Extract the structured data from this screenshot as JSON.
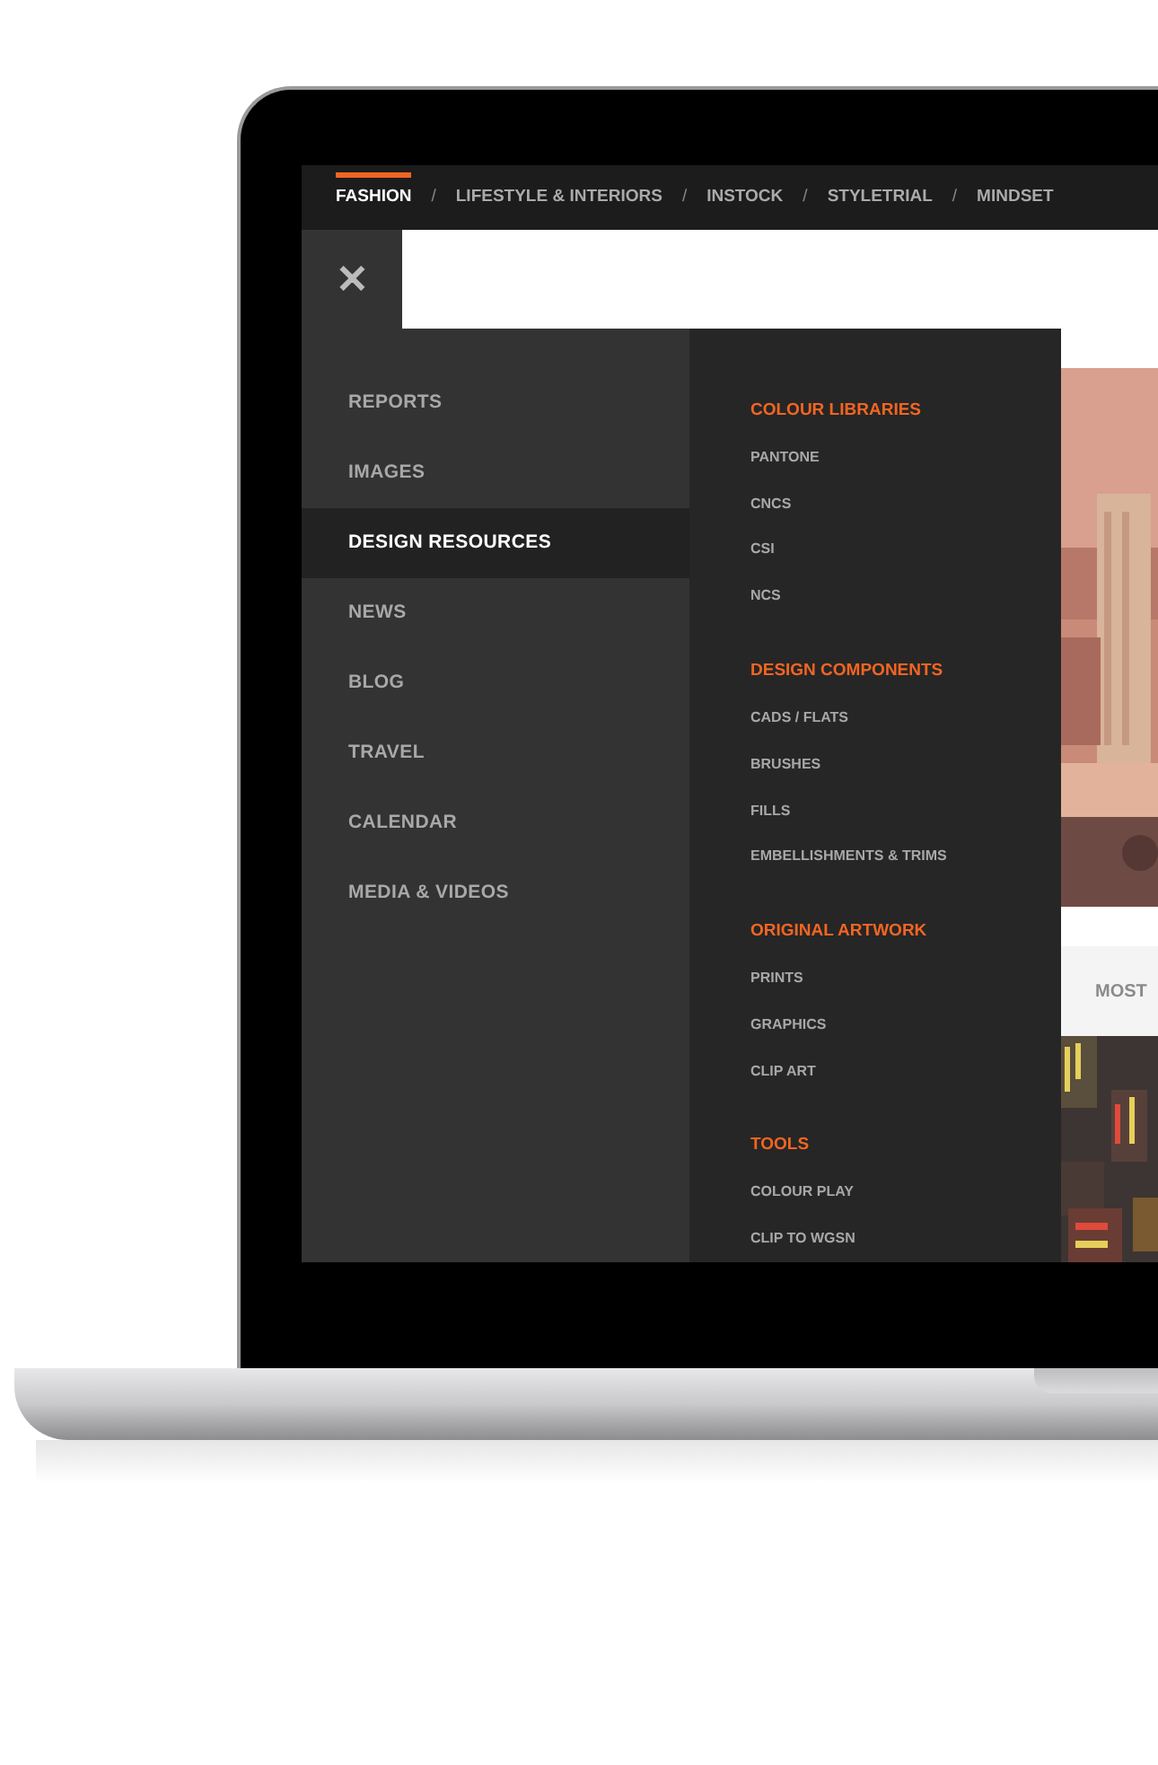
{
  "nav": [
    {
      "label": "FASHION",
      "selected": true
    },
    {
      "label": "LIFESTYLE & INTERIORS",
      "selected": false
    },
    {
      "label": "INSTOCK",
      "selected": false
    },
    {
      "label": "STYLETRIAL",
      "selected": false
    },
    {
      "label": "MINDSET",
      "selected": false
    }
  ],
  "nav_separator": "/",
  "close_button": "✕",
  "sidebar": {
    "items": [
      {
        "label": "REPORTS",
        "selected": false
      },
      {
        "label": "IMAGES",
        "selected": false
      },
      {
        "label": "DESIGN RESOURCES",
        "selected": true
      },
      {
        "label": "NEWS",
        "selected": false
      },
      {
        "label": "BLOG",
        "selected": false
      },
      {
        "label": "TRAVEL",
        "selected": false
      },
      {
        "label": "CALENDAR",
        "selected": false
      },
      {
        "label": "MEDIA & VIDEOS",
        "selected": false
      }
    ]
  },
  "submenu": [
    {
      "heading": "COLOUR LIBRARIES",
      "items": [
        "PANTONE",
        "CNCS",
        "CSI",
        "NCS"
      ]
    },
    {
      "heading": "DESIGN COMPONENTS",
      "items": [
        "CADS / FLATS",
        "BRUSHES",
        "FILLS",
        "EMBELLISHMENTS & TRIMS"
      ]
    },
    {
      "heading": "ORIGINAL ARTWORK",
      "items": [
        "PRINTS",
        "GRAPHICS",
        "CLIP ART"
      ]
    },
    {
      "heading": "TOOLS",
      "items": [
        "COLOUR PLAY",
        "CLIP TO WGSN"
      ]
    }
  ],
  "content": {
    "tab": "MOST"
  }
}
